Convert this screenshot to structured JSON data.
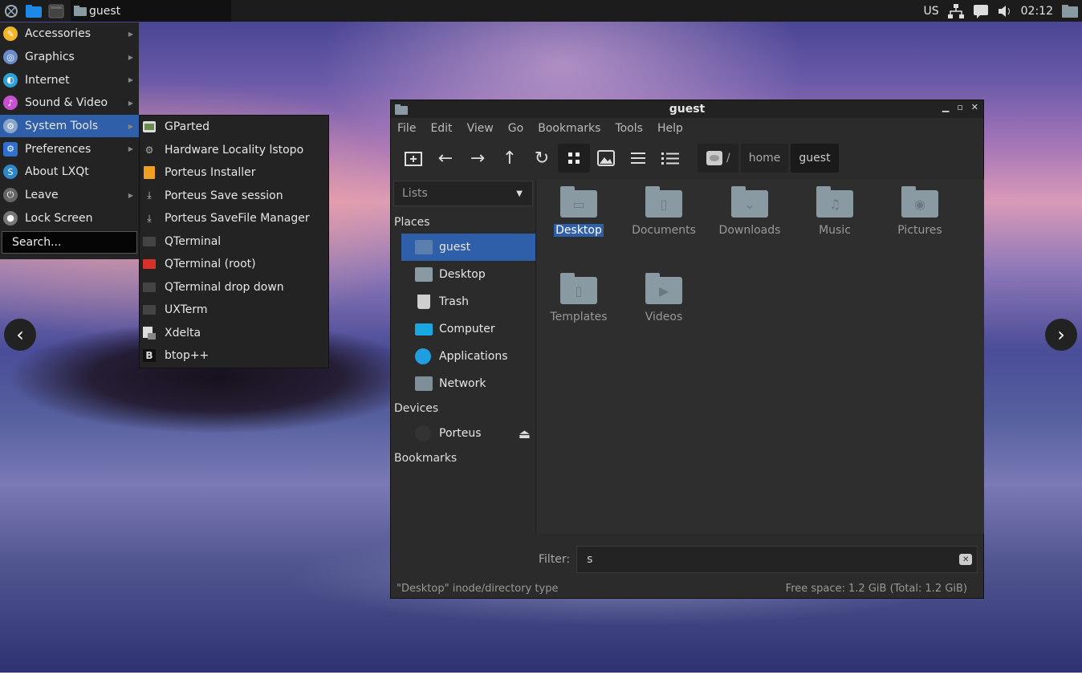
{
  "panel": {
    "task_label": "guest",
    "keyboard_layout": "US",
    "clock": "02:12"
  },
  "main_menu": {
    "items": [
      {
        "label": "Accessories",
        "icon": "accessories-icon",
        "color": "#f0b52a",
        "submenu": true
      },
      {
        "label": "Graphics",
        "icon": "graphics-icon",
        "color": "#6a8cc8",
        "submenu": true
      },
      {
        "label": "Internet",
        "icon": "internet-icon",
        "color": "#2fa0d8",
        "submenu": true
      },
      {
        "label": "Sound & Video",
        "icon": "sound-video-icon",
        "color": "#c84fd0",
        "submenu": true
      },
      {
        "label": "System Tools",
        "icon": "system-tools-icon",
        "color": "#8aa6c8",
        "submenu": true
      },
      {
        "label": "Preferences",
        "icon": "preferences-icon",
        "color": "#2f6fd0",
        "submenu": true
      },
      {
        "label": "About LXQt",
        "icon": "about-icon",
        "color": "#2f86c8",
        "submenu": false
      },
      {
        "label": "Leave",
        "icon": "leave-icon",
        "color": "#666666",
        "submenu": true
      },
      {
        "label": "Lock Screen",
        "icon": "lock-icon",
        "color": "#777777",
        "submenu": false
      }
    ],
    "search_placeholder": "Search..."
  },
  "submenu": {
    "items": [
      {
        "label": "GParted",
        "icon": "gparted-icon"
      },
      {
        "label": "Hardware Locality lstopo",
        "icon": "hwloc-icon"
      },
      {
        "label": "Porteus Installer",
        "icon": "installer-icon"
      },
      {
        "label": "Porteus Save session",
        "icon": "download-icon"
      },
      {
        "label": "Porteus SaveFile Manager",
        "icon": "download-icon"
      },
      {
        "label": "QTerminal",
        "icon": "terminal-icon"
      },
      {
        "label": "QTerminal (root)",
        "icon": "terminal-root-icon"
      },
      {
        "label": "QTerminal drop down",
        "icon": "terminal-icon"
      },
      {
        "label": "UXTerm",
        "icon": "terminal-icon"
      },
      {
        "label": "Xdelta",
        "icon": "xdelta-icon"
      },
      {
        "label": "btop++",
        "icon": "btop-icon"
      }
    ]
  },
  "file_manager": {
    "title": "guest",
    "menu": [
      "File",
      "Edit",
      "View",
      "Go",
      "Bookmarks",
      "Tools",
      "Help"
    ],
    "breadcrumb": {
      "root": "/",
      "items": [
        "home",
        "guest"
      ]
    },
    "side_mode": "Lists",
    "sections": {
      "places": "Places",
      "devices": "Devices",
      "bookmarks": "Bookmarks"
    },
    "places": [
      {
        "label": "guest",
        "selected": true,
        "color": "#5b7fae"
      },
      {
        "label": "Desktop",
        "selected": false,
        "color": "#8a9aa2"
      },
      {
        "label": "Trash",
        "selected": false,
        "color": "#cfcfcf"
      },
      {
        "label": "Computer",
        "selected": false,
        "color": "#1aa7e0"
      },
      {
        "label": "Applications",
        "selected": false,
        "color": "#1f9fe0"
      },
      {
        "label": "Network",
        "selected": false,
        "color": "#7f8f98"
      }
    ],
    "devices": [
      {
        "label": "Porteus"
      }
    ],
    "folders": [
      {
        "label": "Desktop",
        "selected": true,
        "glyph": "▭"
      },
      {
        "label": "Documents",
        "selected": false,
        "glyph": "▯"
      },
      {
        "label": "Downloads",
        "selected": false,
        "glyph": "⌄"
      },
      {
        "label": "Music",
        "selected": false,
        "glyph": "♫"
      },
      {
        "label": "Pictures",
        "selected": false,
        "glyph": "◉"
      },
      {
        "label": "Templates",
        "selected": false,
        "glyph": "▯"
      },
      {
        "label": "Videos",
        "selected": false,
        "glyph": "▶"
      }
    ],
    "filter_label": "Filter:",
    "filter_value": "s",
    "status_left": "\"Desktop\" inode/directory type",
    "status_right": "Free space: 1.2 GiB (Total: 1.2 GiB)"
  }
}
